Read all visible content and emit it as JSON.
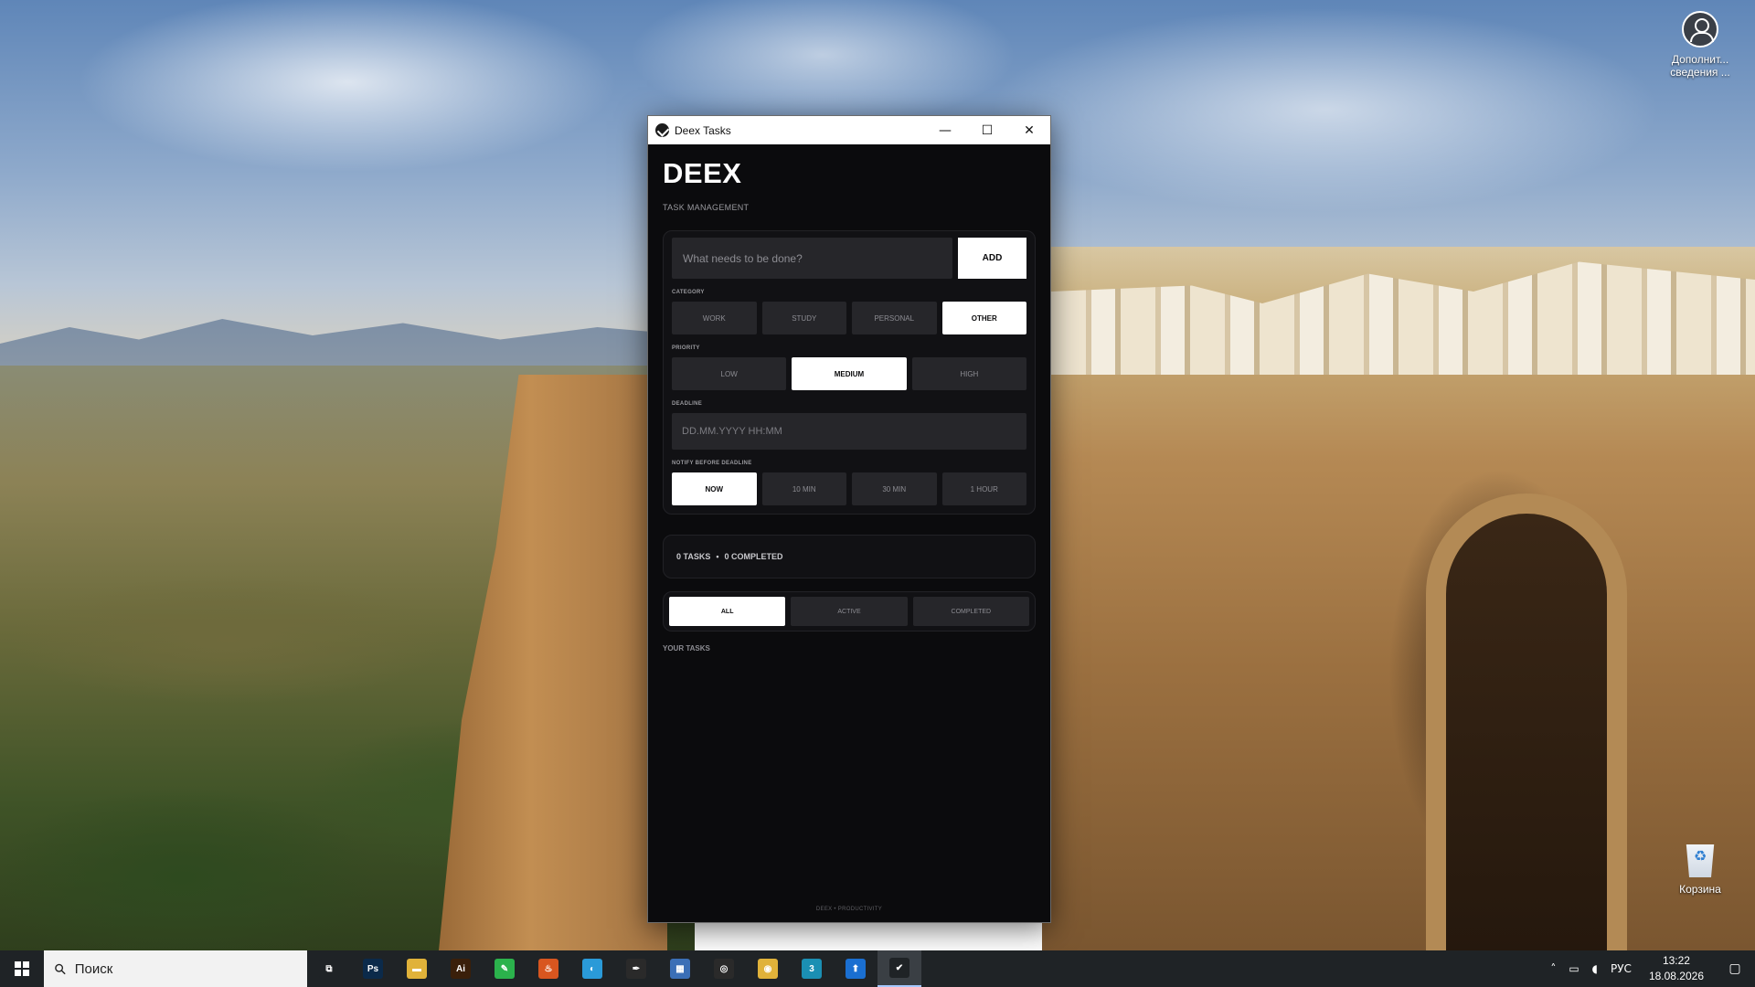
{
  "desktop": {
    "icons": [
      {
        "label": "Дополнит... сведения ..."
      },
      {
        "label": "Корзина"
      }
    ]
  },
  "window": {
    "title": "Deex Tasks",
    "controls": {
      "minimize": "—",
      "maximize": "☐",
      "close": "✕"
    }
  },
  "app": {
    "brand": "DEEX",
    "subtitle": "TASK MANAGEMENT",
    "task_input": {
      "placeholder": "What needs to be done?",
      "value": ""
    },
    "add_label": "ADD",
    "category": {
      "label": "CATEGORY",
      "options": [
        "WORK",
        "STUDY",
        "PERSONAL",
        "OTHER"
      ],
      "selected": "OTHER"
    },
    "priority": {
      "label": "PRIORITY",
      "options": [
        "LOW",
        "MEDIUM",
        "HIGH"
      ],
      "selected": "MEDIUM"
    },
    "deadline": {
      "label": "DEADLINE",
      "placeholder": "DD.MM.YYYY HH:MM",
      "value": ""
    },
    "notify": {
      "label": "NOTIFY BEFORE DEADLINE",
      "options": [
        "NOW",
        "10 MIN",
        "30 MIN",
        "1 HOUR"
      ],
      "selected": "NOW"
    },
    "stats": {
      "tasks": "0 TASKS",
      "separator": "•",
      "completed": "0 COMPLETED"
    },
    "filters": {
      "options": [
        "ALL",
        "ACTIVE",
        "COMPLETED"
      ],
      "selected": "ALL"
    },
    "section_title": "YOUR TASKS",
    "footer": "DEEX • PRODUCTIVITY"
  },
  "taskbar": {
    "search_placeholder": "Поиск",
    "apps": [
      {
        "name": "task-view",
        "glyph": "⧉",
        "color": "#1f2326"
      },
      {
        "name": "photoshop",
        "glyph": "Ps",
        "color": "#0b2a4a"
      },
      {
        "name": "file-explorer",
        "glyph": "▬",
        "color": "#e0b23a"
      },
      {
        "name": "illustrator",
        "glyph": "Ai",
        "color": "#3a1f0a"
      },
      {
        "name": "green-app",
        "glyph": "✎",
        "color": "#2bb24c"
      },
      {
        "name": "orange-app",
        "glyph": "♨",
        "color": "#d8561f"
      },
      {
        "name": "blue-app",
        "glyph": "◐",
        "color": "#2a9ad8"
      },
      {
        "name": "inkscape",
        "glyph": "✒",
        "color": "#2a2a2a"
      },
      {
        "name": "calculator",
        "glyph": "▦",
        "color": "#3b6fb6"
      },
      {
        "name": "blender",
        "glyph": "◎",
        "color": "#2a2a2a"
      },
      {
        "name": "chrome",
        "glyph": "◉",
        "color": "#e0b23a"
      },
      {
        "name": "3ds-max",
        "glyph": "3",
        "color": "#1b8fb3"
      },
      {
        "name": "upload-app",
        "glyph": "⬆",
        "color": "#1a6fd1"
      },
      {
        "name": "deex-tasks",
        "glyph": "✔",
        "color": "#1f2326"
      }
    ],
    "tray": {
      "chevron": "˄",
      "network": "▭",
      "volume": "◖",
      "language": "РУС",
      "time": "13:22",
      "date": "18.08.2026",
      "notifications": "▢"
    }
  }
}
